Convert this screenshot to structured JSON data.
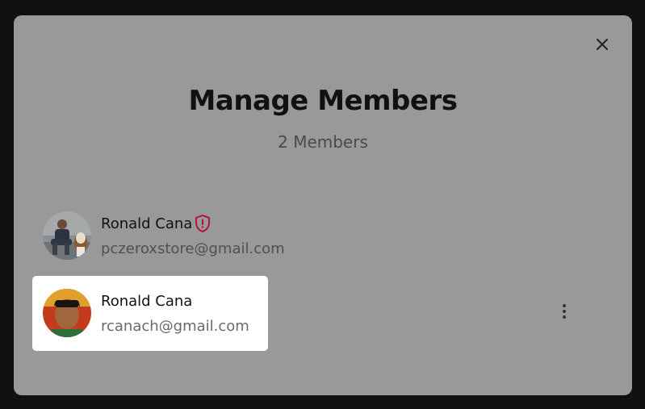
{
  "modal": {
    "title": "Manage Members",
    "member_count": "2 Members",
    "close_icon": "close-icon"
  },
  "members": [
    {
      "name": "Ronald Cana",
      "email": "pczeroxstore@gmail.com",
      "badge_icon": "admin-shield-icon",
      "badge_color": "#b0153a"
    },
    {
      "name": "Ronald Cana",
      "email": "rcanach@gmail.com",
      "actions_icon": "more-vertical-icon"
    }
  ],
  "colors": {
    "backdrop": "#111111",
    "modal_bg": "#999999",
    "selected_row_bg": "#ffffff",
    "title_text": "#111111",
    "admin_badge": "#b0153a"
  }
}
